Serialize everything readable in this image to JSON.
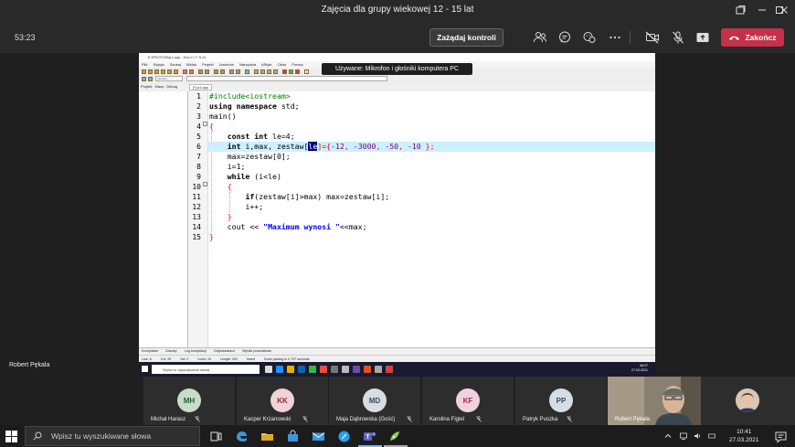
{
  "window": {
    "title": "Zajęcia dla grupy wiekowej 12 - 15 lat"
  },
  "meeting": {
    "timer": "53:23",
    "take_control_label": "Zażądaj kontroli",
    "end_call_label": "Zakończ",
    "presenter_name": "Robert Pękala",
    "end_color": "#c4314b"
  },
  "ide": {
    "title": "E:\\PHOTO\\ll\\p1.cpp - Dev-C++ 5.11",
    "menu": [
      "Plik",
      "Edycja",
      "Szukaj",
      "Widok",
      "Projekt",
      "Uruchom",
      "Narzędzia",
      "AStyle",
      "Okno",
      "Pomoc"
    ],
    "combo": "(globals)",
    "tooltip": "Używane: Mikrofon i głośniki komputera PC",
    "project_tabs": [
      "Projekt",
      "Klasy",
      "Debug"
    ],
    "file_tab": "[*] p1.cpp",
    "line_numbers": [
      "1",
      "2",
      "3",
      "4",
      "5",
      "6",
      "7",
      "8",
      "9",
      "10",
      "11",
      "12",
      "13",
      "14",
      "15"
    ],
    "code": {
      "l1_pp": "#include<iostream>",
      "l2_kw": "using namespace",
      "l2_rest": " std;",
      "l3": "main()",
      "l4": "{",
      "l5_kw": "const int",
      "l5_rest": " le=4;",
      "l6_kw": "int",
      "l6_a": " i,max, zestaw[",
      "l6_sel": "le",
      "l6_b": "]={",
      "l6_n1": "-12",
      "l6_n2": "-3000",
      "l6_n3": "-50",
      "l6_n4": "-10",
      "l6_c": " };",
      "l7": "max=zestaw[0];",
      "l8": "i=1;",
      "l9_kw": "while",
      "l9_rest": " (i<le)",
      "l10": "{",
      "l11_kw": "if",
      "l11_rest": "(zestaw[i]>max) max=zestaw[i];",
      "l12": "i++;",
      "l13": "}",
      "l14_a": "cout << ",
      "l14_str": "\"Maximum wynosi \"",
      "l14_b": "<<max;",
      "l15": "}"
    },
    "message_tabs": [
      "Kompilator",
      "Zasoby",
      "Log kompilacji",
      "Odpluskwiacz",
      "Wyniki poszukiwań"
    ],
    "status": {
      "line_label": "Line:",
      "line": "6",
      "col_label": "Col:",
      "col": "25",
      "sel_label": "Sel:",
      "sel": "2",
      "lines_label": "Lines:",
      "lines": "15",
      "length_label": "Length:",
      "length": "251",
      "mode": "Insert",
      "info": "Done parsing in 0,797 seconds"
    },
    "win_search_placeholder": "Wpisz tu wyszukiwane słowa",
    "win_time": "08:27",
    "win_date": "27.03.2021"
  },
  "participants": [
    {
      "initials": "MH",
      "name": "Michał Harasz",
      "bg": "#c7ddc9",
      "fg": "#2b5a34"
    },
    {
      "initials": "KK",
      "name": "Kacper Krzanowski",
      "bg": "#f1d2d6",
      "fg": "#8c2b3c"
    },
    {
      "initials": "MD",
      "name": "Maja Dąbrowska (Gość)",
      "bg": "#d7dde2",
      "fg": "#3e4a55"
    },
    {
      "initials": "KF",
      "name": "Karolina Figiel",
      "bg": "#f3d0dd",
      "fg": "#9a2a55"
    },
    {
      "initials": "PP",
      "name": "Patryk Puszka",
      "bg": "#d6dde4",
      "fg": "#3b4a5a"
    }
  ],
  "camera_name": "Robert Pękala",
  "taskbar": {
    "search_placeholder": "Wpisz tu wyszukiwane słowa",
    "time": "10:41",
    "date": "27.03.2021"
  }
}
